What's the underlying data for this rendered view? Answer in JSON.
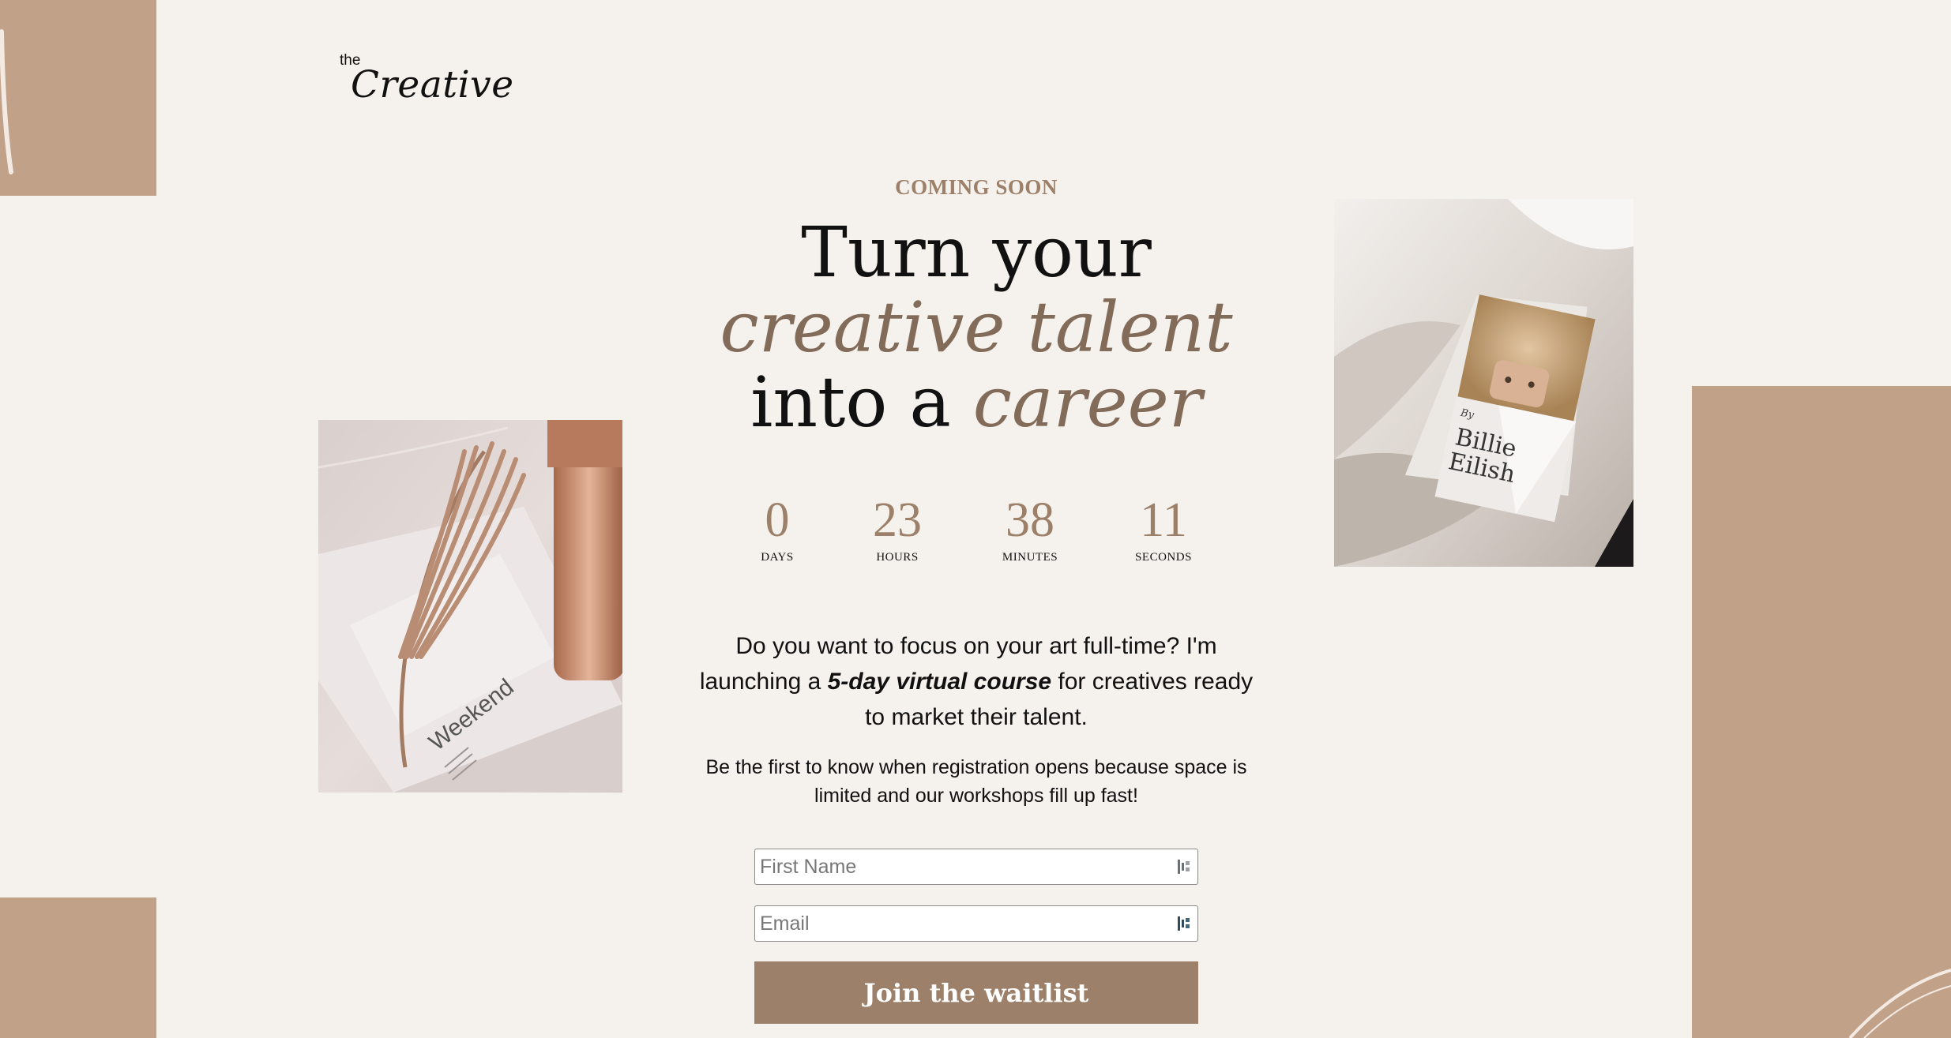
{
  "brand": {
    "small": "the",
    "name": "Creative"
  },
  "hero": {
    "eyebrow": "COMING SOON",
    "line1": "Turn your",
    "line2": "creative talent",
    "line3_prefix": "into a ",
    "line3_accent": "career"
  },
  "countdown": [
    {
      "value": "0",
      "label": "DAYS"
    },
    {
      "value": "23",
      "label": "HOURS"
    },
    {
      "value": "38",
      "label": "MINUTES"
    },
    {
      "value": "11",
      "label": "SECONDS"
    }
  ],
  "intro": {
    "part1": "Do you want to focus on your art full-time? I'm launching a ",
    "emphasis": "5-day virtual course",
    "part2": " for creatives ready to market their talent."
  },
  "subtext": "Be the first to know when registration opens because space is limited and our workshops fill up fast!",
  "form": {
    "first_name_placeholder": "First Name",
    "email_placeholder": "Email",
    "submit_label": "Join the waitlist"
  },
  "images": {
    "left_book_text": "Weekend",
    "right_book_by": "By",
    "right_book_line1": "Billie",
    "right_book_line2": "Eilish"
  },
  "colors": {
    "background": "#f5f1ec",
    "accent": "#9c8069",
    "deco_tan": "#c2a189",
    "headline_italic": "#826b59"
  }
}
